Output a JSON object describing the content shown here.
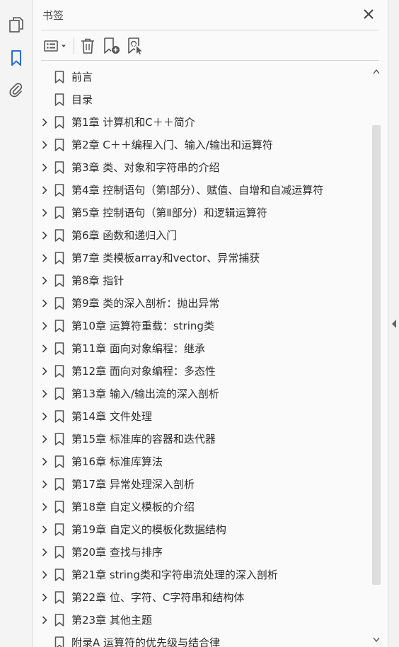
{
  "panel": {
    "title": "书签"
  },
  "left_rail": {
    "items": [
      {
        "name": "pages-icon"
      },
      {
        "name": "bookmarks-icon",
        "active": true
      },
      {
        "name": "attachments-icon"
      }
    ]
  },
  "toolbar": {
    "items": [
      "options-menu-icon",
      "delete-icon",
      "new-bookmark-icon",
      "bookmark-from-selection-icon"
    ]
  },
  "colors": {
    "accent": "#2b6cd6",
    "icon": "#555555",
    "text": "#2d2d2d"
  },
  "bookmarks": [
    {
      "label": "前言",
      "expandable": false
    },
    {
      "label": "目录",
      "expandable": false
    },
    {
      "label": "第1章  计算机和C＋＋简介",
      "expandable": true
    },
    {
      "label": "第2章  C＋＋编程入门、输入/输出和运算符",
      "expandable": true
    },
    {
      "label": "第3章  类、对象和字符串的介绍",
      "expandable": true
    },
    {
      "label": "第4章  控制语句（第Ⅰ部分）、赋值、自增和自减运算符",
      "expandable": true
    },
    {
      "label": "第5章  控制语句（第Ⅱ部分）和逻辑运算符",
      "expandable": true
    },
    {
      "label": "第6章  函数和递归入门",
      "expandable": true
    },
    {
      "label": "第7章  类模板array和vector、异常捕获",
      "expandable": true
    },
    {
      "label": "第8章  指针",
      "expandable": true
    },
    {
      "label": "第9章  类的深入剖析：抛出异常",
      "expandable": true
    },
    {
      "label": "第10章  运算符重载：string类",
      "expandable": true
    },
    {
      "label": "第11章  面向对象编程：继承",
      "expandable": true
    },
    {
      "label": "第12章  面向对象编程：多态性",
      "expandable": true
    },
    {
      "label": "第13章  输入/输出流的深入剖析",
      "expandable": true
    },
    {
      "label": "第14章  文件处理",
      "expandable": true
    },
    {
      "label": "第15章  标准库的容器和迭代器",
      "expandable": true
    },
    {
      "label": "第16章  标准库算法",
      "expandable": true
    },
    {
      "label": "第17章  异常处理深入剖析",
      "expandable": true
    },
    {
      "label": "第18章  自定义模板的介绍",
      "expandable": true
    },
    {
      "label": "第19章  自定义的模板化数据结构",
      "expandable": true
    },
    {
      "label": "第20章  查找与排序",
      "expandable": true
    },
    {
      "label": "第21章  string类和字符串流处理的深入剖析",
      "expandable": true
    },
    {
      "label": "第22章  位、字符、C字符串和结构体",
      "expandable": true
    },
    {
      "label": "第23章  其他主题",
      "expandable": true
    },
    {
      "label": "附录A  运算符的优先级与结合律",
      "expandable": false
    }
  ]
}
